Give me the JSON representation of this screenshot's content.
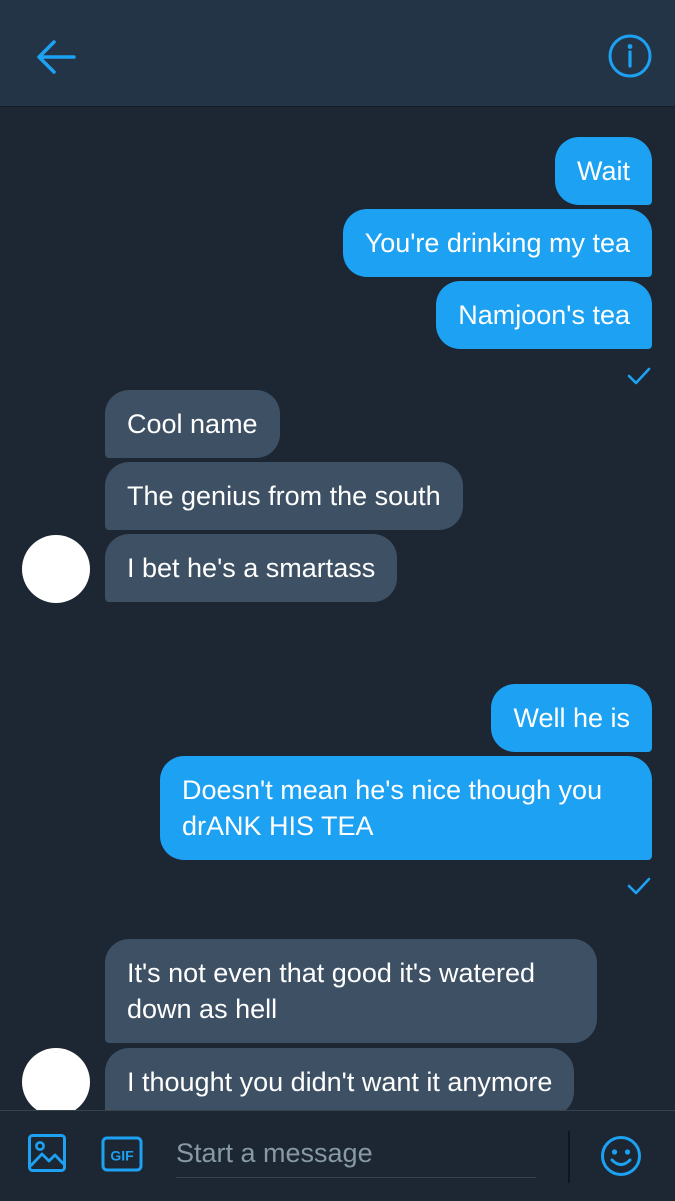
{
  "header": {
    "back_icon": "arrow-left-icon",
    "info_icon": "info-icon"
  },
  "messages": [
    {
      "dir": "out",
      "text": "Wait"
    },
    {
      "dir": "out",
      "text": "You're drinking my tea"
    },
    {
      "dir": "out",
      "text": "Namjoon's tea"
    },
    {
      "dir": "in",
      "text": "Cool name"
    },
    {
      "dir": "in",
      "text": "The genius from the south"
    },
    {
      "dir": "in",
      "text": "I bet he's a smartass"
    },
    {
      "dir": "out",
      "text": "Well he is"
    },
    {
      "dir": "out",
      "text": "Doesn't mean he's nice though you drANK HIS TEA"
    },
    {
      "dir": "in",
      "text": "It's not even that good it's watered down as hell"
    },
    {
      "dir": "in",
      "text": "I thought you didn't want it anymore"
    }
  ],
  "composer": {
    "placeholder": "Start a message",
    "gif_label": "GIF",
    "media_icon": "image-icon",
    "emoji_icon": "emoji-icon"
  },
  "colors": {
    "background": "#1c2733",
    "header": "#243447",
    "outgoing_bubble": "#1da1f2",
    "incoming_bubble": "#3d5064",
    "accent": "#1da1f2"
  }
}
